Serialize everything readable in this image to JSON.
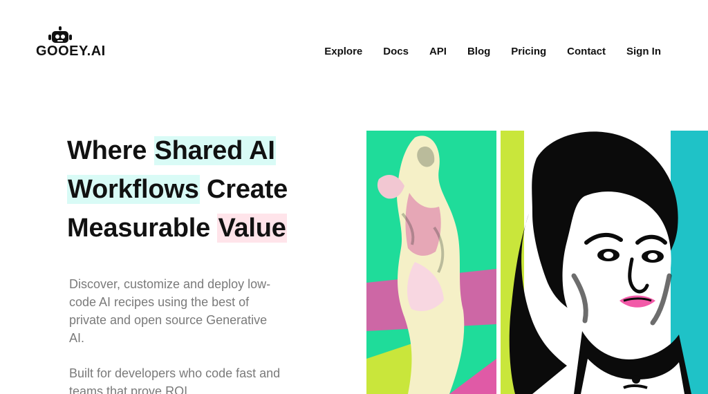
{
  "brand": {
    "logo_text": "GOOEY.AI"
  },
  "nav": {
    "items": [
      {
        "label": "Explore",
        "name": "nav-explore"
      },
      {
        "label": "Docs",
        "name": "nav-docs"
      },
      {
        "label": "API",
        "name": "nav-api"
      },
      {
        "label": "Blog",
        "name": "nav-blog"
      },
      {
        "label": "Pricing",
        "name": "nav-pricing"
      },
      {
        "label": "Contact",
        "name": "nav-contact"
      },
      {
        "label": "Sign In",
        "name": "nav-sign-in"
      }
    ]
  },
  "hero": {
    "title": {
      "line1_prefix": "Where ",
      "line1_highlight": "Shared AI",
      "line2_highlight": "Workflows",
      "line2_suffix": " Create",
      "line3_prefix": "Measurable ",
      "line3_highlight": "Value"
    },
    "subtitle": "Discover, customize and deploy low-code AI recipes using the best of private and open source Generative AI.",
    "subtitle_2": "Built for developers who code fast and teams that prove ROI."
  },
  "colors": {
    "accent_cyan": "#d9fbf6",
    "accent_pink": "#ffe4ea",
    "art_green": "#1fdc9a",
    "art_lime": "#c9e63b",
    "art_magenta": "#e05aa6",
    "art_teal": "#1fc2c7"
  },
  "icons": {
    "logo": "robot-icon"
  }
}
